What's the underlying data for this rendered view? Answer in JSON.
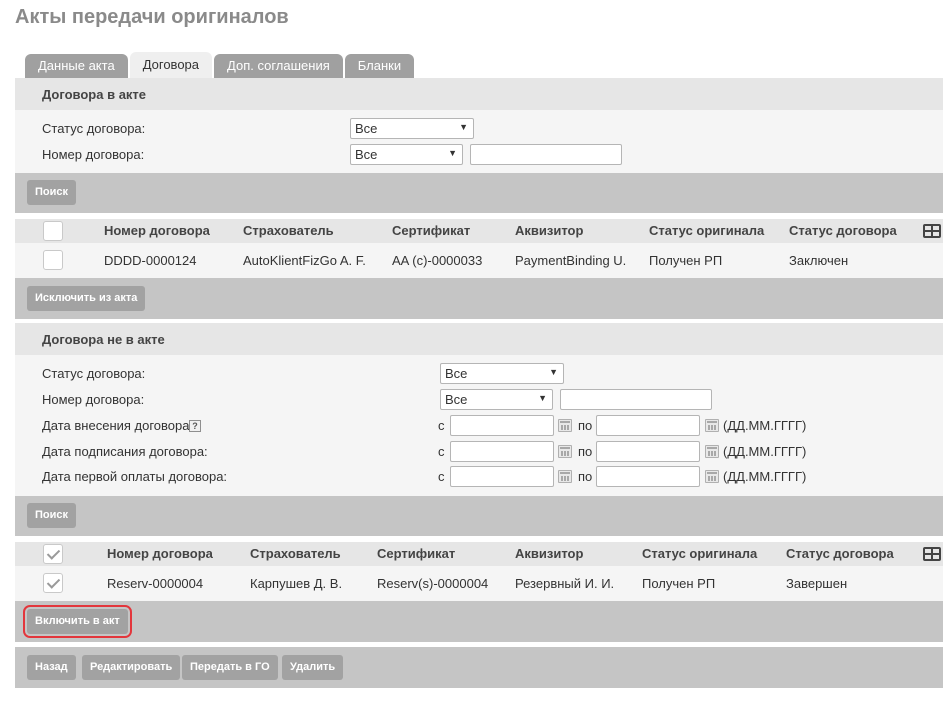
{
  "page": {
    "title": "Акты передачи оригиналов"
  },
  "tabs": [
    {
      "label": "Данные акта",
      "active": false
    },
    {
      "label": "Договора",
      "active": true
    },
    {
      "label": "Доп. соглашения",
      "active": false
    },
    {
      "label": "Бланки",
      "active": false
    }
  ],
  "in_act": {
    "header": "Договора в акте",
    "filters": {
      "status_label": "Статус договора:",
      "status_value": "Все",
      "number_label": "Номер договора:",
      "number_mode": "Все",
      "number_value": ""
    },
    "search_button": "Поиск",
    "columns": [
      "Номер договора",
      "Страхователь",
      "Сертификат",
      "Аквизитор",
      "Статус оригинала",
      "Статус договора"
    ],
    "rows": [
      {
        "number": "DDDD-0000124",
        "insurer": "AutoKlientFizGo A. F.",
        "certificate": "AA (c)-0000033",
        "agent": "PaymentBinding U.",
        "original_status": "Получен РП",
        "contract_status": "Заключен",
        "checked": false
      }
    ],
    "exclude_button": "Исключить из акта"
  },
  "not_in_act": {
    "header": "Договора не в акте",
    "filters": {
      "status_label": "Статус договора:",
      "status_value": "Все",
      "number_label": "Номер договора:",
      "number_mode": "Все",
      "number_value": "",
      "entry_date_label": "Дата внесения договора:",
      "sign_date_label": "Дата подписания договора:",
      "first_payment_label": "Дата первой оплаты договора:",
      "from_label": "с",
      "to_label": "по",
      "date_format": "(ДД.ММ.ГГГГ)",
      "help_glyph": "?"
    },
    "search_button": "Поиск",
    "columns": [
      "Номер договора",
      "Страхователь",
      "Сертификат",
      "Аквизитор",
      "Статус оригинала",
      "Статус договора"
    ],
    "rows": [
      {
        "number": "Reserv-0000004",
        "insurer": "Карпушев Д. В.",
        "certificate": "Reserv(s)-0000004",
        "agent": "Резервный И. И.",
        "original_status": "Получен РП",
        "contract_status": "Завершен",
        "checked": true
      }
    ],
    "include_button": "Включить в акт"
  },
  "footer": {
    "back": "Назад",
    "edit": "Редактировать",
    "transfer": "Передать в ГО",
    "delete": "Удалить"
  },
  "icons": {
    "dropdown": "chevron-down-icon",
    "calendar": "calendar-icon",
    "columns": "grid-icon",
    "help": "help-icon"
  },
  "colors": {
    "button": "#a2a2a2",
    "highlight_outline": "#e3363c"
  }
}
